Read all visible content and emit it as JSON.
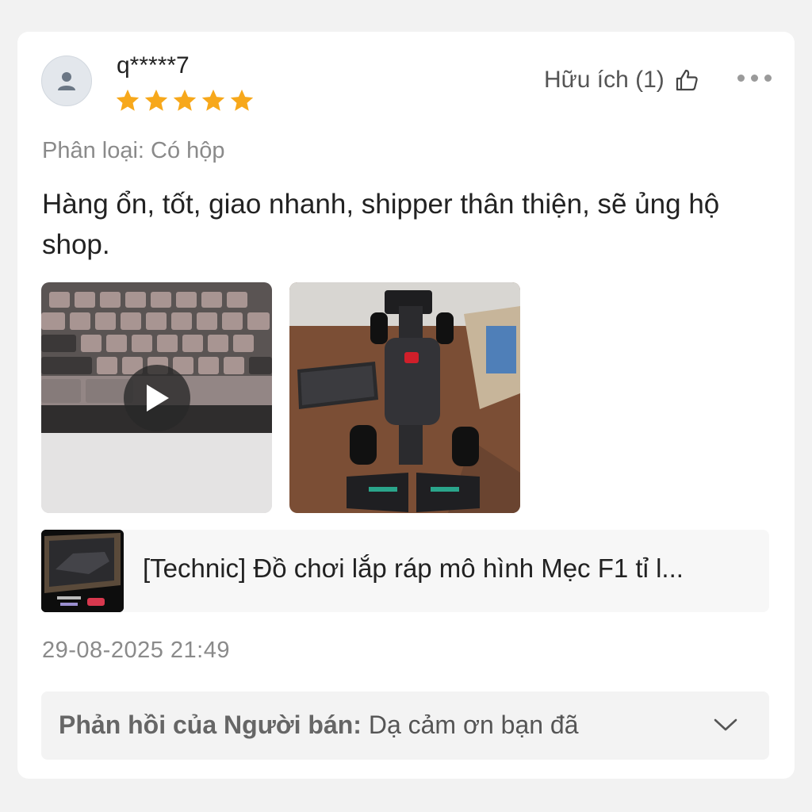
{
  "review": {
    "username": "q*****7",
    "rating": 5,
    "helpful_label": "Hữu ích (1)",
    "variant": "Phân loại: Có hộp",
    "text": "Hàng ổn, tốt, giao nhanh, shipper thân thiện, sẽ ủng hộ shop.",
    "timestamp": "29-08-2025 21:49"
  },
  "icons": {
    "avatar": "user-avatar-icon",
    "star": "star-icon",
    "helpful": "thumbs-up-icon",
    "more": "more-horizontal-icon",
    "play": "play-icon",
    "expand": "chevron-down-icon"
  },
  "media": [
    {
      "type": "video",
      "description_icon": "play-icon"
    },
    {
      "type": "image"
    }
  ],
  "product": {
    "name": "[Technic] Đồ chơi lắp ráp mô hình Mẹc F1 tỉ l..."
  },
  "seller_reply": {
    "label": "Phản hồi của Người bán:",
    "text": " Dạ cảm ơn bạn đã"
  },
  "colors": {
    "star": "#f7a81b",
    "muted_text": "#8a8a8a",
    "card_bg": "#ffffff"
  }
}
